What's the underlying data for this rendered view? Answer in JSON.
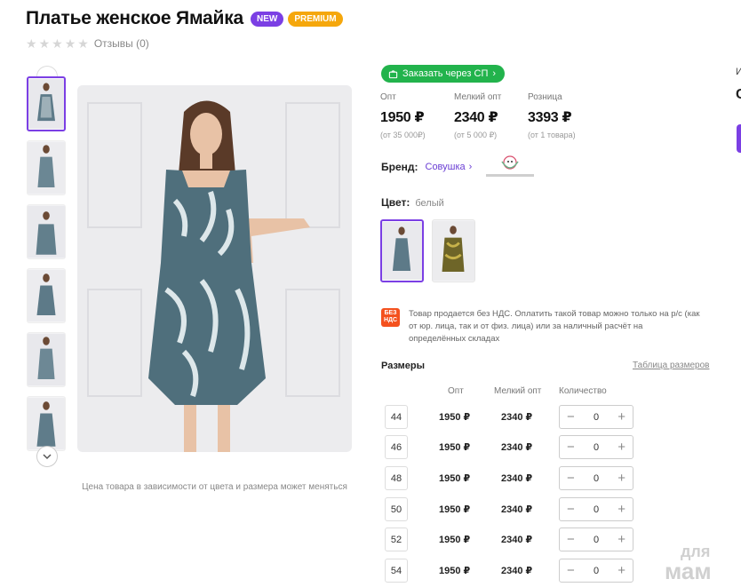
{
  "product": {
    "title": "Платье женское Ямайка",
    "badges": [
      "NEW",
      "PREMIUM"
    ],
    "rating_stars": 0,
    "reviews_label": "Отзывы (0)",
    "price_note": "Цена товара в зависимости от цвета и размера может меняться"
  },
  "order_button": {
    "label": "Заказать через СП"
  },
  "prices": [
    {
      "label": "Опт",
      "value": "1950 ₽",
      "sub": "(от 35 000₽)"
    },
    {
      "label": "Мелкий опт",
      "value": "2340 ₽",
      "sub": "(от 5 000 ₽)"
    },
    {
      "label": "Розница",
      "value": "3393 ₽",
      "sub": "(от 1 товара)"
    }
  ],
  "brand": {
    "label": "Бренд:",
    "name": "Совушка"
  },
  "color": {
    "label": "Цвет:",
    "value": "белый"
  },
  "nds": {
    "icon_text": "БЕЗ НДС",
    "text": "Товар продается без НДС. Оплатить такой товар можно только на р/с (как от юр. лица, так и от физ. лица) или за наличный расчёт на определённых складах"
  },
  "sizes": {
    "title": "Размеры",
    "table_link": "Таблица размеров",
    "headers": {
      "opt": "Опт",
      "small_opt": "Мелкий опт",
      "qty": "Количество"
    },
    "rows": [
      {
        "size": "44",
        "opt": "1950 ₽",
        "small_opt": "2340 ₽",
        "qty": "0"
      },
      {
        "size": "46",
        "opt": "1950 ₽",
        "small_opt": "2340 ₽",
        "qty": "0"
      },
      {
        "size": "48",
        "opt": "1950 ₽",
        "small_opt": "2340 ₽",
        "qty": "0"
      },
      {
        "size": "50",
        "opt": "1950 ₽",
        "small_opt": "2340 ₽",
        "qty": "0"
      },
      {
        "size": "52",
        "opt": "1950 ₽",
        "small_opt": "2340 ₽",
        "qty": "0"
      },
      {
        "size": "54",
        "opt": "1950 ₽",
        "small_opt": "2340 ₽",
        "qty": "0"
      }
    ]
  },
  "edge": {
    "letter": "И",
    "letter2": "С"
  },
  "watermark": {
    "line1": "для",
    "line2": "мам"
  },
  "colors": {
    "accent": "#7b3fe4",
    "green": "#22b34c",
    "orange": "#f5a70c",
    "nds": "#f4511e"
  }
}
